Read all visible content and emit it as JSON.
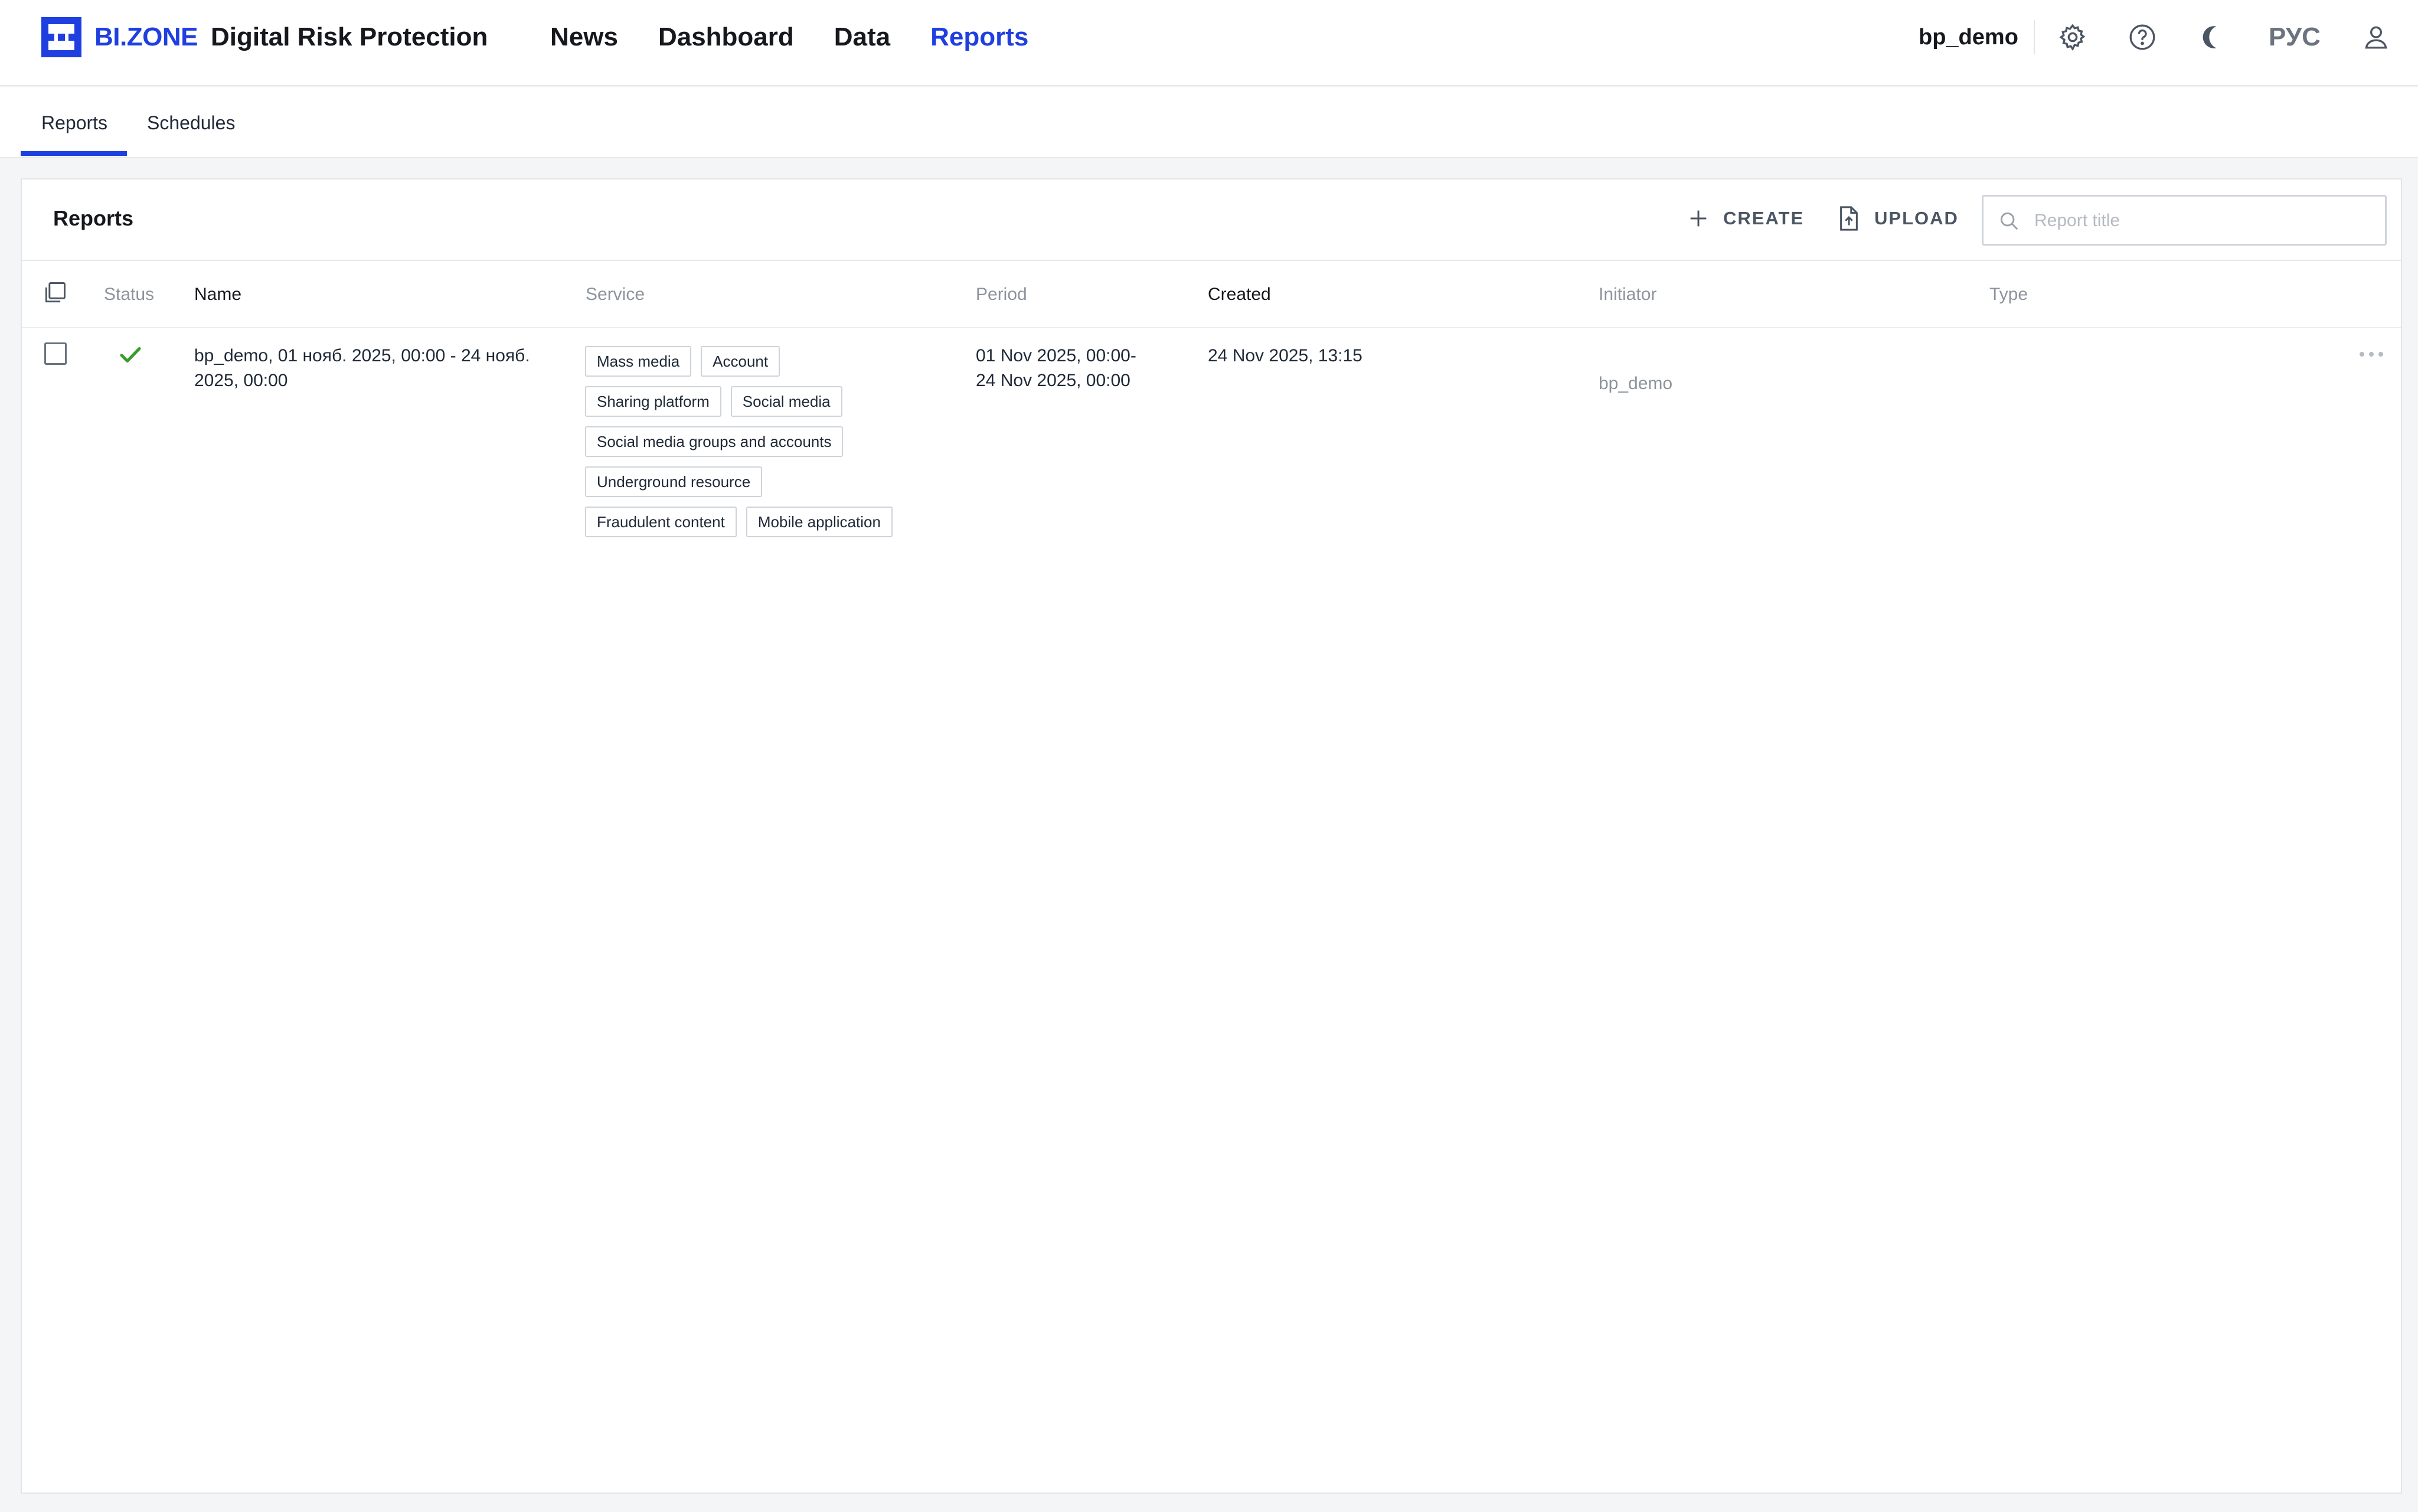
{
  "header": {
    "brand": "BI.ZONE",
    "product": "Digital Risk Protection",
    "nav": [
      "News",
      "Dashboard",
      "Data",
      "Reports"
    ],
    "active_nav": "Reports",
    "username": "bp_demo",
    "language": "РУС",
    "accent_color": "#1f3fe0"
  },
  "subtabs": [
    "Reports",
    "Schedules"
  ],
  "panel": {
    "title": "Reports",
    "create_label": "CREATE",
    "upload_label": "UPLOAD",
    "search_placeholder": "Report title"
  },
  "table": {
    "columns": [
      "Status",
      "Name",
      "Service",
      "Period",
      "Created",
      "Initiator",
      "Type"
    ],
    "rows": [
      {
        "status": "completed",
        "name_line1": "bp_demo, 01 нояб. 2025, 00:00 - 24 нояб.",
        "name_line2": "2025, 00:00",
        "services": [
          [
            "Mass media",
            "Account"
          ],
          [
            "Sharing platform",
            "Social media"
          ],
          [
            "Social media groups and accounts"
          ],
          [
            "Underground resource"
          ],
          [
            "Fraudulent content",
            "Mobile application"
          ]
        ],
        "period_line1": "01 Nov 2025, 00:00-",
        "period_line2": "24 Nov 2025, 00:00",
        "created": "24 Nov 2025, 13:15",
        "initiator": "bp_demo",
        "type": ""
      }
    ]
  }
}
